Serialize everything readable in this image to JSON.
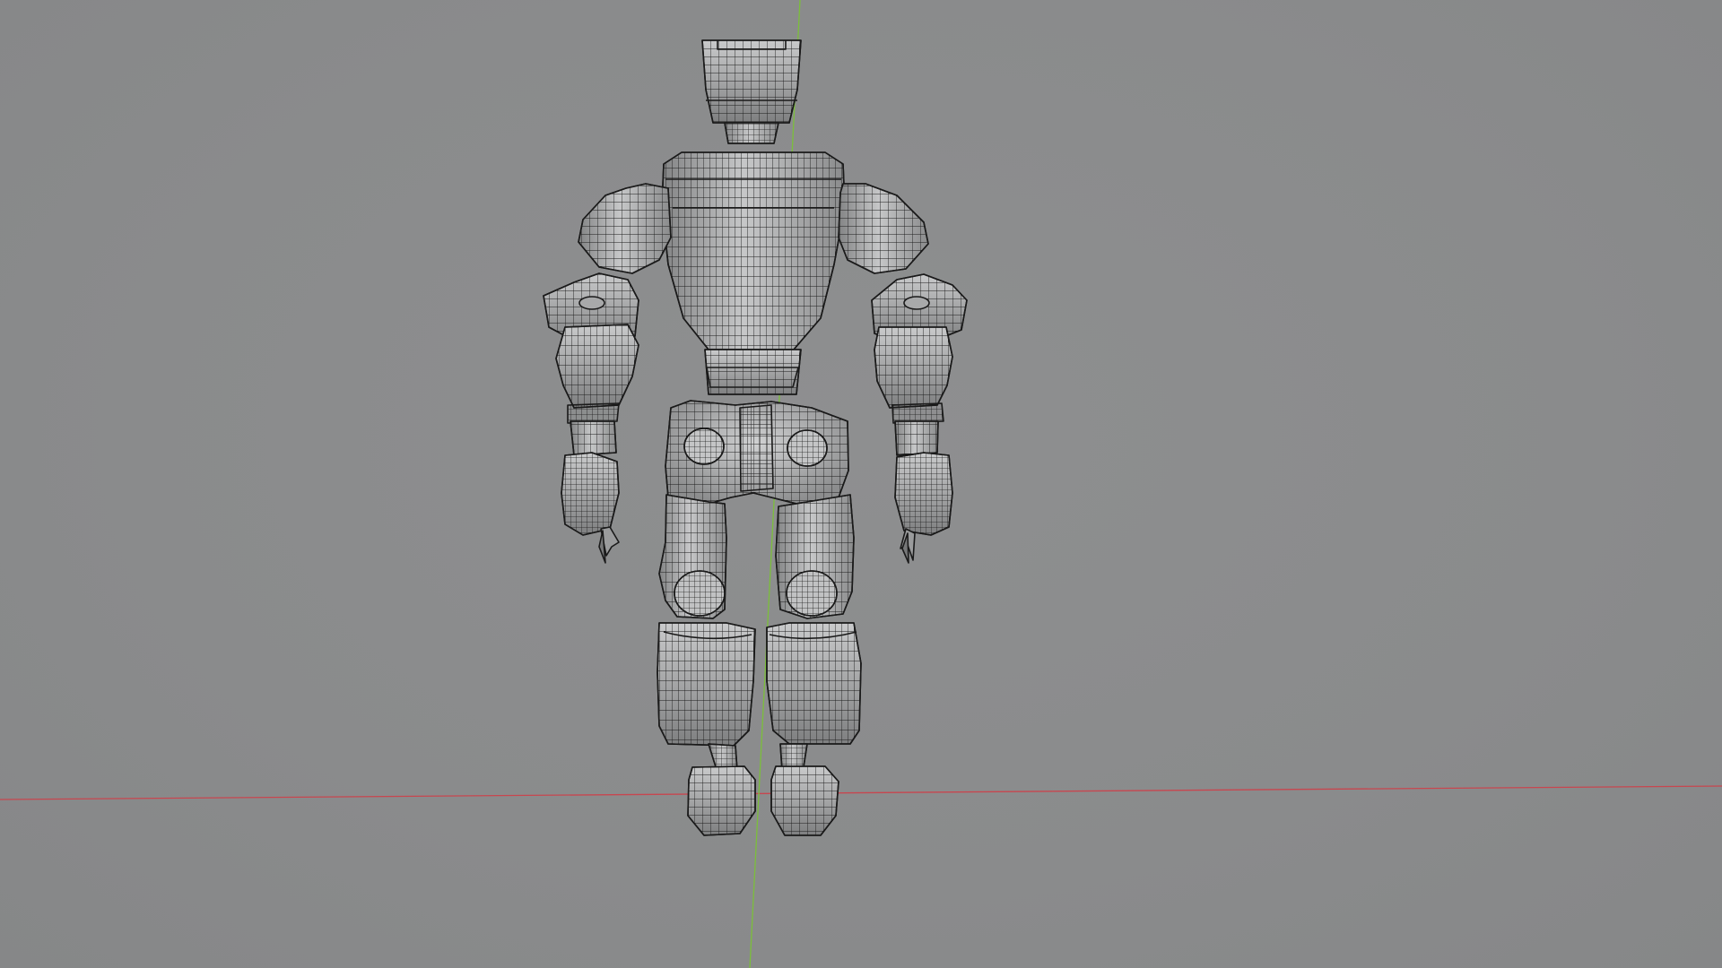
{
  "viewport": {
    "background": "#8a8b8c",
    "shading": "solid-wireframe",
    "x_axis_color": "#c8464f",
    "y_axis_color": "#7bbf3a",
    "mesh_fill": "#9a9b9c",
    "mesh_fill_light": "#c4c5c6",
    "wire_color": "#1a1a1a"
  },
  "model": {
    "kind": "robot-humanoid",
    "view": "front"
  }
}
